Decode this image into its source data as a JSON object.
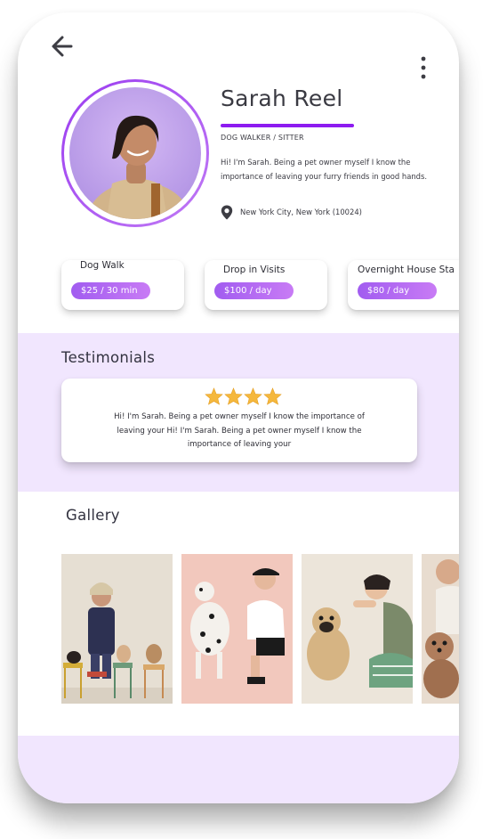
{
  "header": {
    "back_icon": "arrow-left-icon",
    "more_icon": "more-vertical-icon"
  },
  "profile": {
    "name": "Sarah Reel",
    "role": "DOG WALKER / SITTER",
    "bio": "Hi! I'm Sarah. Being a pet owner myself I know the importance of leaving your furry friends in good hands.",
    "location": "New York City, New York (10024)",
    "location_icon": "map-pin-icon",
    "accent": "#8d1bf0"
  },
  "services": [
    {
      "title": "Dog Walk",
      "price": "$25 / 30 min"
    },
    {
      "title": "Drop in Visits",
      "price": "$100 / day"
    },
    {
      "title": "Overnight House Sta",
      "price": "$80 / day"
    }
  ],
  "testimonials": {
    "title": "Testimonials",
    "rating": 4,
    "text": "Hi! I'm Sarah. Being a pet owner myself I know the importance of leaving your Hi! I'm Sarah. Being a pet owner myself I know the importance of leaving your"
  },
  "gallery": {
    "title": "Gallery"
  },
  "colors": {
    "section_bg": "#f1e6fe",
    "pill_start": "#a15cf0",
    "pill_end": "#c87bf5",
    "star": "#f5b83d"
  }
}
